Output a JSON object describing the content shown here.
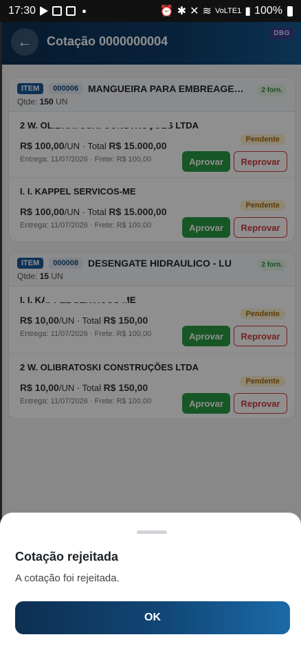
{
  "status_bar": {
    "time": "17:30",
    "battery_text": "100%",
    "network_label": "VoLTE1",
    "icons": [
      "play-store-icon",
      "notification-icon",
      "notification-icon",
      "alarm-icon",
      "bluetooth-icon",
      "mute-icon",
      "wifi-icon",
      "signal-icon",
      "battery-icon"
    ]
  },
  "header": {
    "title": "Cotação 0000000004",
    "back_icon": "←",
    "debug_badge": "DBG"
  },
  "items": [
    {
      "tag": "ITEM",
      "code": "000006",
      "name": "MANGUEIRA PARA EMBREAGEM ...",
      "suppliers_badge": "2 forn.",
      "qtde_label": "Qtde:",
      "qtde_value": "150",
      "qtde_unit": "UN",
      "suppliers": [
        {
          "name": "2 W. OLIBRATOSKI CONSTRUÇÕES LTDA",
          "price": "R$ 100,00",
          "unit": "/UN",
          "total_label": "Total",
          "total": "R$ 15.000,00",
          "meta": "Entrega: 11/07/2026 · Frete: R$ 100,00",
          "status": "Pendente",
          "approve": "Aprovar",
          "reject": "Reprovar"
        },
        {
          "name": "I. I. KAPPEL SERVICOS-ME",
          "price": "R$ 100,00",
          "unit": "/UN",
          "total_label": "Total",
          "total": "R$ 15.000,00",
          "meta": "Entrega: 11/07/2026 · Frete: R$ 100,00",
          "status": "Pendente",
          "approve": "Aprovar",
          "reject": "Reprovar"
        }
      ]
    },
    {
      "tag": "ITEM",
      "code": "000008",
      "name": "DESENGATE HIDRAULICO - LU",
      "suppliers_badge": "2 forn.",
      "qtde_label": "Qtde:",
      "qtde_value": "15",
      "qtde_unit": "UN",
      "suppliers": [
        {
          "name": "I. I. KAPPEL SERVICOS-ME",
          "price": "R$ 10,00",
          "unit": "/UN",
          "total_label": "Total",
          "total": "R$ 150,00",
          "meta": "Entrega: 11/07/2026 · Frete: R$ 100,00",
          "status": "Pendente",
          "approve": "Aprovar",
          "reject": "Reprovar"
        },
        {
          "name": "2 W. OLIBRATOSKI CONSTRUÇÕES LTDA",
          "price": "R$ 10,00",
          "unit": "/UN",
          "total_label": "Total",
          "total": "R$ 150,00",
          "meta": "Entrega: 11/07/2026 · Frete: R$ 100,00",
          "status": "Pendente",
          "approve": "Aprovar",
          "reject": "Reprovar"
        }
      ]
    }
  ],
  "dialog": {
    "title": "Cotação rejeitada",
    "message": "A cotação foi rejeitada.",
    "ok": "OK"
  },
  "colors": {
    "primary": "#0f3e6a",
    "approve": "#2a9c45",
    "reject": "#d23a3a",
    "pending_bg": "#fdf0d2"
  }
}
